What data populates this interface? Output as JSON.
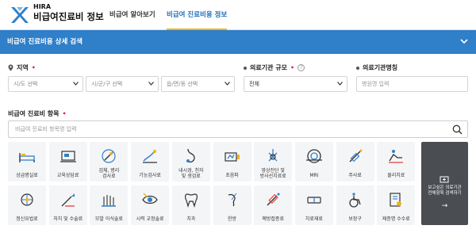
{
  "header": {
    "brand_en": "HIRA",
    "brand_ko": "비급여진료비 정보",
    "nav": [
      "비급여 알아보기",
      "비급여 진료비용 정보"
    ]
  },
  "bluebar": {
    "title": "비급여 진료비용 상세 검색"
  },
  "filters": {
    "region_label": "지역",
    "sido_placeholder": "시/도 선택",
    "sigungu_placeholder": "시/군/구 선택",
    "dong_placeholder": "읍/면/동 선택",
    "scale_label": "의료기관 규모",
    "scale_value": "전체",
    "name_label": "의료기관명칭",
    "name_placeholder": "병원명 입력",
    "items_label": "비급여 진료비 항목",
    "items_placeholder": "비급여 진료비 항목명 입력"
  },
  "tiles": [
    {
      "label": "상급병실료",
      "icon": "bed-icon"
    },
    {
      "label": "교육상담료",
      "icon": "counsel-icon"
    },
    {
      "label": "검체, 병리\n검사료",
      "icon": "lab-test-icon"
    },
    {
      "label": "기능검사료",
      "icon": "function-test-icon"
    },
    {
      "label": "내시경, 천자\n및 생검료",
      "icon": "endoscope-icon"
    },
    {
      "label": "초음파",
      "icon": "ultrasound-icon"
    },
    {
      "label": "영상진단 및\n방사선치료료",
      "icon": "radiology-icon"
    },
    {
      "label": "MRI",
      "icon": "mri-icon"
    },
    {
      "label": "주사료",
      "icon": "syringe-icon"
    },
    {
      "label": "물리치료",
      "icon": "physio-icon"
    },
    {
      "label": "정신요법료",
      "icon": "psych-icon"
    },
    {
      "label": "처치 및 수술료",
      "icon": "surgery-icon"
    },
    {
      "label": "모발 이식술료",
      "icon": "hair-icon"
    },
    {
      "label": "시력 교정술료",
      "icon": "vision-icon"
    },
    {
      "label": "치과",
      "icon": "tooth-icon"
    },
    {
      "label": "한방",
      "icon": "acupuncture-icon"
    },
    {
      "label": "예방접종료",
      "icon": "vaccine-icon"
    },
    {
      "label": "치료재료",
      "icon": "material-icon"
    },
    {
      "label": "보장구",
      "icon": "wheelchair-icon"
    },
    {
      "label": "제증명 수수료",
      "icon": "certificate-icon"
    }
  ],
  "cta": {
    "text": "보고싶은 의료기관\n전체항목 검색하기",
    "arrow": "→"
  },
  "colors": {
    "brand_blue": "#2f7fc9",
    "accent_yellow": "#f0b21c",
    "required_red": "#d9304f"
  }
}
